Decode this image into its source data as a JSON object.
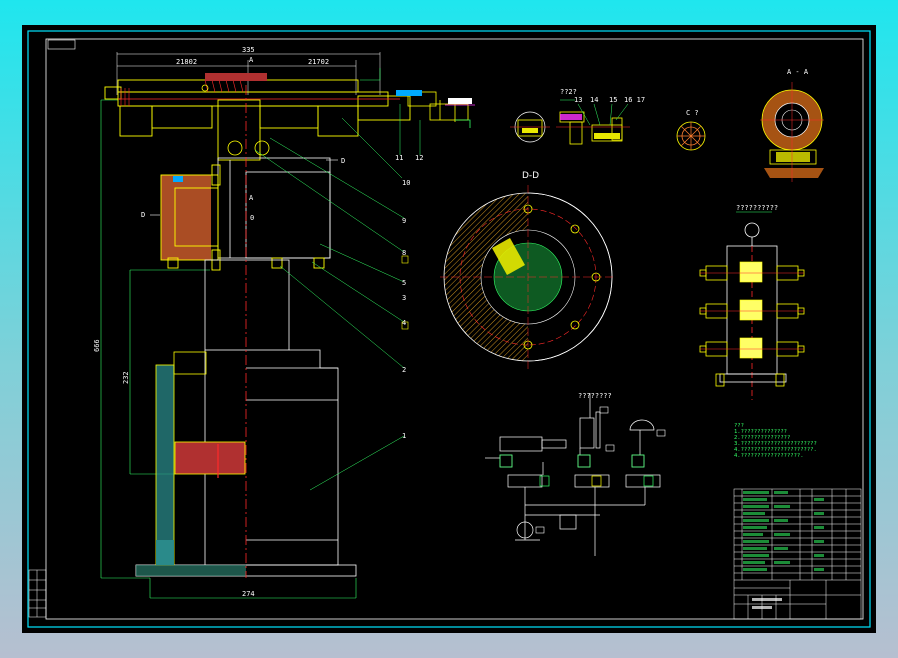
{
  "drawing": {
    "background": "#000000",
    "frame_color": "#00e5ff",
    "accent_colors": {
      "yellow": "#ffff00",
      "green": "#33ff66",
      "red": "#ff2a2a",
      "magenta": "#ff33ff",
      "white": "#ffffff",
      "hatch_red": "#ff3030",
      "hatch_yellow": "#e8e800"
    },
    "dimensions": {
      "top_width": "335",
      "top_left_span": "21802",
      "top_right_span": "21702",
      "height_total": "666",
      "height_inner": "232",
      "base_width": "274"
    },
    "section_marks": {
      "a_top": "A",
      "a_mid": "A",
      "d_left": "D",
      "d_right": "D",
      "o_mark": "0"
    },
    "part_numbers": [
      "11",
      "12",
      "10",
      "9",
      "8",
      "5",
      "4",
      "3",
      "2",
      "1"
    ],
    "detail_views": {
      "section_dd": "D-D",
      "section_aa": "A - A",
      "detail_small": "??2?",
      "detail_callouts": [
        "13",
        "14",
        "15",
        "16 17"
      ],
      "detail_c": "C ?",
      "valve_block": "??????????",
      "hydraulic": "????????"
    },
    "notes": {
      "heading": "???",
      "lines": [
        "1.??????????????",
        "2.???????????????",
        "3.???????????????????????",
        "4.??????????????????????.",
        "4.??????????????????."
      ]
    },
    "title_block": {
      "rows": [
        [
          "",
          "",
          "",
          "",
          ""
        ],
        [
          "",
          "",
          "",
          "",
          ""
        ],
        [
          "",
          "",
          "",
          "",
          ""
        ],
        [
          "",
          "",
          "",
          "",
          ""
        ],
        [
          "",
          "",
          "",
          "",
          ""
        ],
        [
          "",
          "",
          "",
          "",
          ""
        ],
        [
          "",
          "",
          "",
          "",
          ""
        ],
        [
          "",
          "",
          "",
          "",
          ""
        ],
        [
          "",
          "",
          "",
          "",
          ""
        ],
        [
          "",
          "",
          "",
          "",
          ""
        ]
      ]
    }
  }
}
